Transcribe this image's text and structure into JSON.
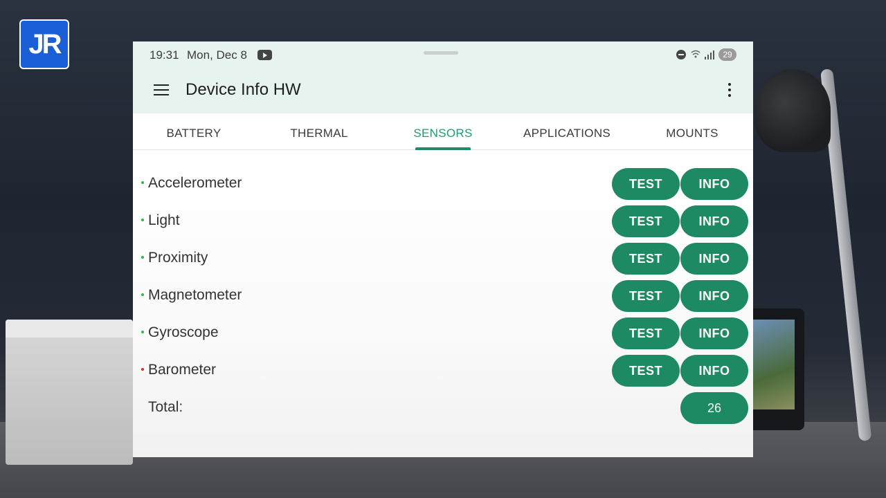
{
  "logo": {
    "text": "JR"
  },
  "statusbar": {
    "time": "19:31",
    "date": "Mon, Dec 8",
    "battery": "29",
    "icons": [
      "youtube-icon",
      "do-not-disturb-icon",
      "wifi-icon",
      "signal-icon",
      "battery-icon"
    ]
  },
  "appbar": {
    "title": "Device Info HW",
    "icons": [
      "menu-icon",
      "more-vert-icon"
    ]
  },
  "tabs": [
    {
      "label": "BATTERY",
      "active": false
    },
    {
      "label": "THERMAL",
      "active": false
    },
    {
      "label": "SENSORS",
      "active": true
    },
    {
      "label": "APPLICATIONS",
      "active": false
    },
    {
      "label": "MOUNTS",
      "active": false
    }
  ],
  "sensors": [
    {
      "name": "Accelerometer",
      "status_color": "#2fb84c",
      "test_label": "TEST",
      "info_label": "INFO"
    },
    {
      "name": "Light",
      "status_color": "#2fb84c",
      "test_label": "TEST",
      "info_label": "INFO"
    },
    {
      "name": "Proximity",
      "status_color": "#2fb84c",
      "test_label": "TEST",
      "info_label": "INFO"
    },
    {
      "name": "Magnetometer",
      "status_color": "#2fb84c",
      "test_label": "TEST",
      "info_label": "INFO"
    },
    {
      "name": "Gyroscope",
      "status_color": "#2fb84c",
      "test_label": "TEST",
      "info_label": "INFO"
    },
    {
      "name": "Barometer",
      "status_color": "#d32f2f",
      "test_label": "TEST",
      "info_label": "INFO"
    }
  ],
  "total": {
    "label": "Total:",
    "value": "26"
  },
  "colors": {
    "accent": "#1e8a64",
    "active_tab": "#1f9a74",
    "appbar_bg": "#e6f3ef"
  }
}
